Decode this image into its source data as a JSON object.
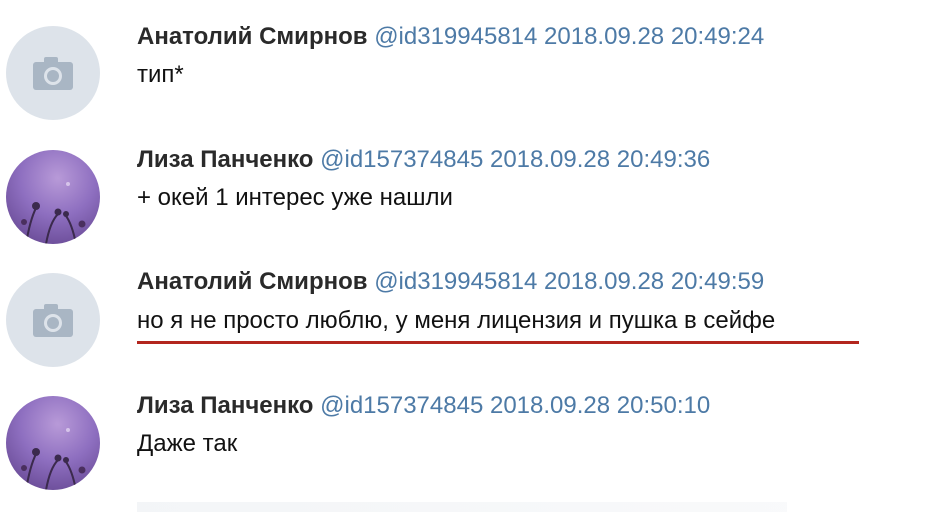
{
  "messages": [
    {
      "author": "Анатолий Смирнов",
      "handle": "@id319945814",
      "timestamp": "2018.09.28 20:49:24",
      "text": "тип*",
      "avatar": "camera-placeholder"
    },
    {
      "author": "Лиза Панченко",
      "handle": "@id157374845",
      "timestamp": "2018.09.28 20:49:36",
      "text": "+ окей 1 интерес уже нашли",
      "avatar": "photo"
    },
    {
      "author": "Анатолий Смирнов",
      "handle": "@id319945814",
      "timestamp": "2018.09.28 20:49:59",
      "text": "но я не просто люблю, у меня лицензия и пушка в сейфе",
      "avatar": "camera-placeholder",
      "highlight_color": "#b3261e"
    },
    {
      "author": "Лиза Панченко",
      "handle": "@id157374845",
      "timestamp": "2018.09.28 20:50:10",
      "text": "Даже так",
      "avatar": "photo"
    }
  ],
  "colors": {
    "handle": "#4d7aa6",
    "author": "#2a2a2a",
    "text": "#111111",
    "placeholder_bg": "#dde3ea"
  }
}
